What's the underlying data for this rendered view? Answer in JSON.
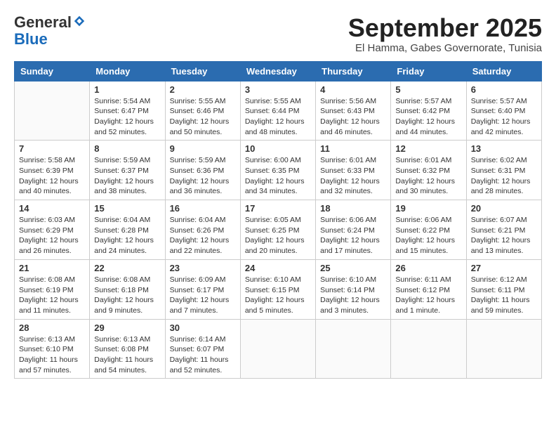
{
  "header": {
    "logo_general": "General",
    "logo_blue": "Blue",
    "month_title": "September 2025",
    "location": "El Hamma, Gabes Governorate, Tunisia"
  },
  "calendar": {
    "days_of_week": [
      "Sunday",
      "Monday",
      "Tuesday",
      "Wednesday",
      "Thursday",
      "Friday",
      "Saturday"
    ],
    "weeks": [
      [
        {
          "day": "",
          "info": ""
        },
        {
          "day": "1",
          "info": "Sunrise: 5:54 AM\nSunset: 6:47 PM\nDaylight: 12 hours\nand 52 minutes."
        },
        {
          "day": "2",
          "info": "Sunrise: 5:55 AM\nSunset: 6:46 PM\nDaylight: 12 hours\nand 50 minutes."
        },
        {
          "day": "3",
          "info": "Sunrise: 5:55 AM\nSunset: 6:44 PM\nDaylight: 12 hours\nand 48 minutes."
        },
        {
          "day": "4",
          "info": "Sunrise: 5:56 AM\nSunset: 6:43 PM\nDaylight: 12 hours\nand 46 minutes."
        },
        {
          "day": "5",
          "info": "Sunrise: 5:57 AM\nSunset: 6:42 PM\nDaylight: 12 hours\nand 44 minutes."
        },
        {
          "day": "6",
          "info": "Sunrise: 5:57 AM\nSunset: 6:40 PM\nDaylight: 12 hours\nand 42 minutes."
        }
      ],
      [
        {
          "day": "7",
          "info": "Sunrise: 5:58 AM\nSunset: 6:39 PM\nDaylight: 12 hours\nand 40 minutes."
        },
        {
          "day": "8",
          "info": "Sunrise: 5:59 AM\nSunset: 6:37 PM\nDaylight: 12 hours\nand 38 minutes."
        },
        {
          "day": "9",
          "info": "Sunrise: 5:59 AM\nSunset: 6:36 PM\nDaylight: 12 hours\nand 36 minutes."
        },
        {
          "day": "10",
          "info": "Sunrise: 6:00 AM\nSunset: 6:35 PM\nDaylight: 12 hours\nand 34 minutes."
        },
        {
          "day": "11",
          "info": "Sunrise: 6:01 AM\nSunset: 6:33 PM\nDaylight: 12 hours\nand 32 minutes."
        },
        {
          "day": "12",
          "info": "Sunrise: 6:01 AM\nSunset: 6:32 PM\nDaylight: 12 hours\nand 30 minutes."
        },
        {
          "day": "13",
          "info": "Sunrise: 6:02 AM\nSunset: 6:31 PM\nDaylight: 12 hours\nand 28 minutes."
        }
      ],
      [
        {
          "day": "14",
          "info": "Sunrise: 6:03 AM\nSunset: 6:29 PM\nDaylight: 12 hours\nand 26 minutes."
        },
        {
          "day": "15",
          "info": "Sunrise: 6:04 AM\nSunset: 6:28 PM\nDaylight: 12 hours\nand 24 minutes."
        },
        {
          "day": "16",
          "info": "Sunrise: 6:04 AM\nSunset: 6:26 PM\nDaylight: 12 hours\nand 22 minutes."
        },
        {
          "day": "17",
          "info": "Sunrise: 6:05 AM\nSunset: 6:25 PM\nDaylight: 12 hours\nand 20 minutes."
        },
        {
          "day": "18",
          "info": "Sunrise: 6:06 AM\nSunset: 6:24 PM\nDaylight: 12 hours\nand 17 minutes."
        },
        {
          "day": "19",
          "info": "Sunrise: 6:06 AM\nSunset: 6:22 PM\nDaylight: 12 hours\nand 15 minutes."
        },
        {
          "day": "20",
          "info": "Sunrise: 6:07 AM\nSunset: 6:21 PM\nDaylight: 12 hours\nand 13 minutes."
        }
      ],
      [
        {
          "day": "21",
          "info": "Sunrise: 6:08 AM\nSunset: 6:19 PM\nDaylight: 12 hours\nand 11 minutes."
        },
        {
          "day": "22",
          "info": "Sunrise: 6:08 AM\nSunset: 6:18 PM\nDaylight: 12 hours\nand 9 minutes."
        },
        {
          "day": "23",
          "info": "Sunrise: 6:09 AM\nSunset: 6:17 PM\nDaylight: 12 hours\nand 7 minutes."
        },
        {
          "day": "24",
          "info": "Sunrise: 6:10 AM\nSunset: 6:15 PM\nDaylight: 12 hours\nand 5 minutes."
        },
        {
          "day": "25",
          "info": "Sunrise: 6:10 AM\nSunset: 6:14 PM\nDaylight: 12 hours\nand 3 minutes."
        },
        {
          "day": "26",
          "info": "Sunrise: 6:11 AM\nSunset: 6:12 PM\nDaylight: 12 hours\nand 1 minute."
        },
        {
          "day": "27",
          "info": "Sunrise: 6:12 AM\nSunset: 6:11 PM\nDaylight: 11 hours\nand 59 minutes."
        }
      ],
      [
        {
          "day": "28",
          "info": "Sunrise: 6:13 AM\nSunset: 6:10 PM\nDaylight: 11 hours\nand 57 minutes."
        },
        {
          "day": "29",
          "info": "Sunrise: 6:13 AM\nSunset: 6:08 PM\nDaylight: 11 hours\nand 54 minutes."
        },
        {
          "day": "30",
          "info": "Sunrise: 6:14 AM\nSunset: 6:07 PM\nDaylight: 11 hours\nand 52 minutes."
        },
        {
          "day": "",
          "info": ""
        },
        {
          "day": "",
          "info": ""
        },
        {
          "day": "",
          "info": ""
        },
        {
          "day": "",
          "info": ""
        }
      ]
    ]
  }
}
